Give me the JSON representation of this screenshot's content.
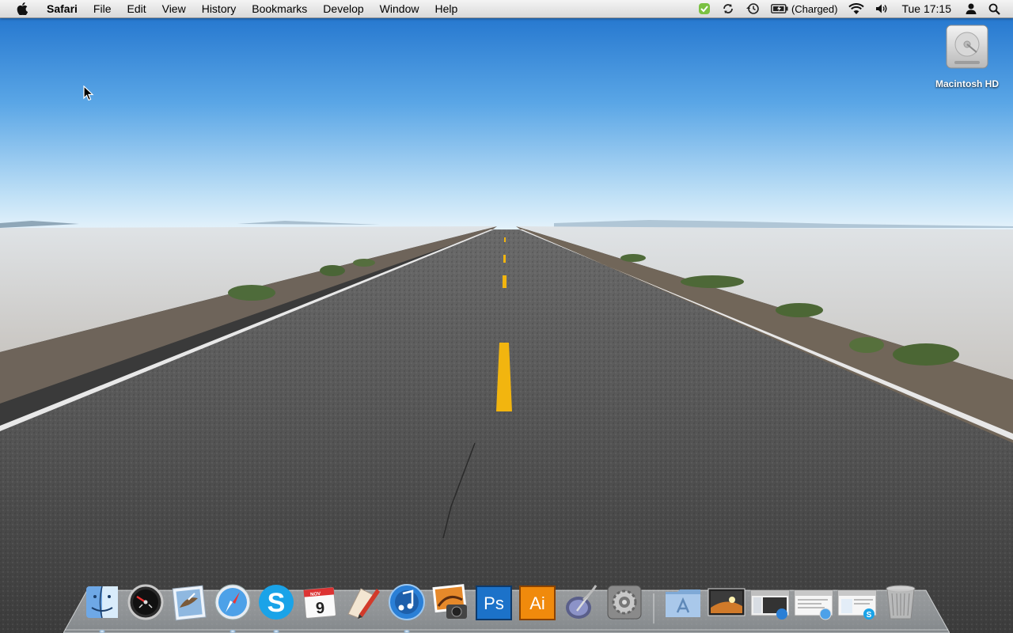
{
  "menubar": {
    "apple_icon": "apple-icon",
    "app_name": "Safari",
    "menus": [
      "File",
      "Edit",
      "View",
      "History",
      "Bookmarks",
      "Develop",
      "Window",
      "Help"
    ],
    "status": {
      "evernote_icon": "evernote-icon",
      "sync_icon": "sync-icon",
      "time_machine_icon": "time-machine-icon",
      "battery_icon": "battery-icon",
      "battery_text": "(Charged)",
      "wifi_icon": "wifi-icon",
      "volume_icon": "volume-icon",
      "clock": "Tue 17:15",
      "user_icon": "user-icon",
      "spotlight_icon": "spotlight-icon"
    }
  },
  "desktop": {
    "icons": [
      {
        "name": "Macintosh HD",
        "icon": "hard-drive-icon"
      }
    ]
  },
  "dock": {
    "apps": [
      {
        "icon": "finder-icon",
        "running": true
      },
      {
        "icon": "dashboard-icon",
        "running": false
      },
      {
        "icon": "mail-icon",
        "running": false
      },
      {
        "icon": "safari-icon",
        "running": true
      },
      {
        "icon": "skype-icon",
        "running": true
      },
      {
        "icon": "ical-icon",
        "running": false,
        "month": "NOV",
        "day": "9"
      },
      {
        "icon": "textedit-pen-icon",
        "running": false
      },
      {
        "icon": "itunes-icon",
        "running": true
      },
      {
        "icon": "iphoto-icon",
        "running": false
      },
      {
        "icon": "photoshop-icon",
        "running": false,
        "label": "Ps"
      },
      {
        "icon": "illustrator-icon",
        "running": false,
        "label": "Ai"
      },
      {
        "icon": "script-editor-icon",
        "running": false
      },
      {
        "icon": "system-preferences-icon",
        "running": false
      }
    ],
    "others": [
      {
        "icon": "applications-folder-icon"
      },
      {
        "icon": "wallpaper-window-icon"
      },
      {
        "icon": "itunes-window-icon"
      },
      {
        "icon": "safari-window-icon"
      },
      {
        "icon": "skype-window-icon"
      },
      {
        "icon": "trash-icon"
      }
    ]
  },
  "colors": {
    "sky_top": "#1f78d0",
    "sky_horizon": "#d8ecf8",
    "asphalt": "#4a4a4a",
    "center_line": "#f2b50f",
    "menubar": "#e8e8e8"
  }
}
